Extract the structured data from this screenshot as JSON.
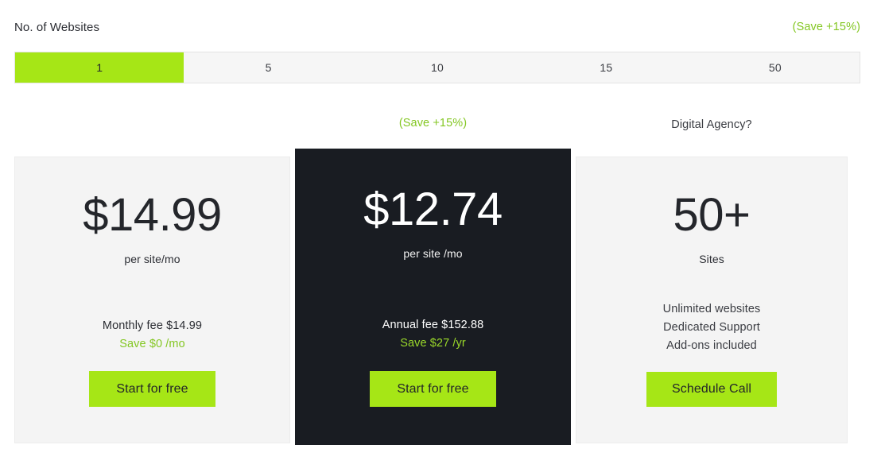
{
  "selector": {
    "label": "No. of Websites",
    "save_badge": "(Save +15%)",
    "options": [
      "1",
      "5",
      "10",
      "15",
      "50"
    ],
    "selected_index": 0,
    "active_color": "#a6e616",
    "track_color": "#f6f6f6"
  },
  "captions": {
    "middle": "(Save +15%)",
    "right": "Digital Agency?"
  },
  "cards": {
    "left": {
      "price": "$14.99",
      "unit": "per site/mo",
      "fee": "Monthly fee $14.99",
      "save": "Save $0 /mo",
      "cta": "Start for free"
    },
    "middle": {
      "price": "$12.74",
      "unit": "per site /mo",
      "fee": "Annual fee $152.88",
      "save": "Save $27 /yr",
      "cta": "Start for free",
      "background": "#191c22"
    },
    "right": {
      "price": "50+",
      "unit": "Sites",
      "features": [
        "Unlimited websites",
        "Dedicated Support",
        "Add-ons included"
      ],
      "cta": "Schedule Call"
    }
  },
  "colors": {
    "accent_green": "#a6e616",
    "save_text_green": "#84c723",
    "dark": "#191c22",
    "light_card": "#f4f4f4"
  }
}
